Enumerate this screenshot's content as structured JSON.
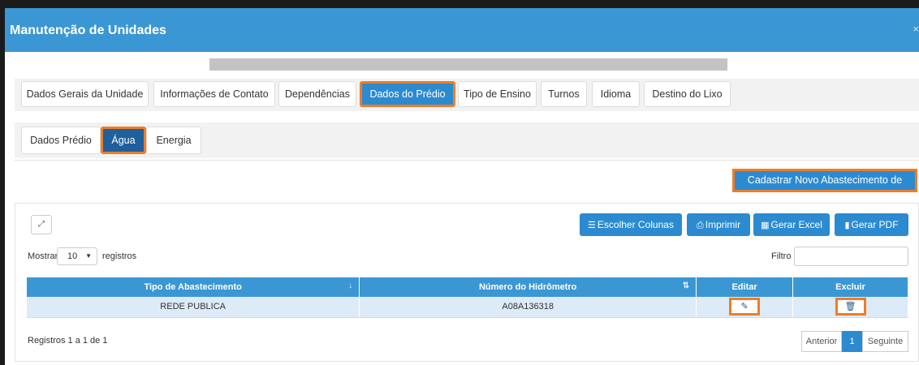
{
  "window": {
    "title": "Manutenção de Unidades",
    "close_symbol": "×"
  },
  "tabs": [
    {
      "label": "Dados Gerais da Unidade",
      "active": false
    },
    {
      "label": "Informações de Contato",
      "active": false
    },
    {
      "label": "Dependências",
      "active": false
    },
    {
      "label": "Dados do Prédio",
      "active": true
    },
    {
      "label": "Tipo de Ensino",
      "active": false
    },
    {
      "label": "Turnos",
      "active": false
    },
    {
      "label": "Idioma",
      "active": false
    },
    {
      "label": "Destino do Lixo",
      "active": false
    }
  ],
  "subtabs": [
    {
      "label": "Dados Prédio",
      "active": false
    },
    {
      "label": "Água",
      "active": true
    },
    {
      "label": "Energia",
      "active": false
    }
  ],
  "actions": {
    "cadastrar_label": "Cadastrar Novo Abastecimento de Água"
  },
  "toolbar": {
    "escolher_colunas": "Escolher Colunas",
    "imprimir": "Imprimir",
    "gerar_excel": "Gerar Excel",
    "gerar_pdf": "Gerar PDF"
  },
  "length_control": {
    "prefix": "Mostrar",
    "value": "10",
    "suffix": "registros"
  },
  "filter": {
    "label": "Filtro",
    "value": ""
  },
  "table": {
    "columns": [
      "Tipo de Abastecimento",
      "Número do Hidrômetro",
      "Editar",
      "Excluir"
    ],
    "rows": [
      {
        "tipo": "REDE PUBLICA",
        "hidrometro": "A08A136318"
      }
    ]
  },
  "footer": {
    "info": "Registros 1 a 1 de 1",
    "prev": "Anterior",
    "page": "1",
    "next": "Seguinte"
  },
  "colors": {
    "header": "#3b97d3",
    "accent": "#2c8bd0",
    "highlight": "#ef7d27",
    "active_subtab": "#1f5f9c"
  },
  "icons": [
    "expand-icon",
    "list-icon",
    "print-icon",
    "table-icon",
    "file-icon",
    "pencil-icon",
    "trash-icon",
    "sort-icon"
  ]
}
